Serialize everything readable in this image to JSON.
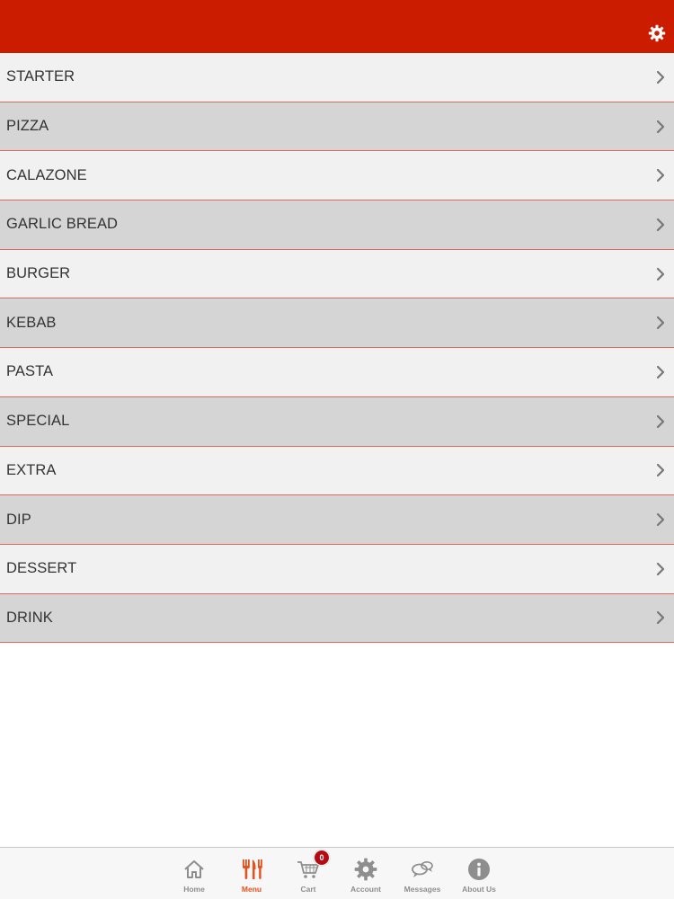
{
  "header": {
    "settings_icon": "gear-icon"
  },
  "colors": {
    "header": "#cc1c00",
    "row_odd": "#f2f1f1",
    "row_even": "#d6d5d5",
    "divider": "#d96a5c",
    "active_tab": "#e8501c"
  },
  "menu": {
    "items": [
      {
        "label": "STARTER"
      },
      {
        "label": "PIZZA"
      },
      {
        "label": "CALAZONE"
      },
      {
        "label": "GARLIC BREAD"
      },
      {
        "label": "BURGER"
      },
      {
        "label": "KEBAB"
      },
      {
        "label": "PASTA"
      },
      {
        "label": "SPECIAL"
      },
      {
        "label": "EXTRA"
      },
      {
        "label": "DIP"
      },
      {
        "label": "DESSERT"
      },
      {
        "label": "DRINK"
      }
    ]
  },
  "tabbar": {
    "tabs": [
      {
        "label": "Home",
        "icon": "home-icon"
      },
      {
        "label": "Menu",
        "icon": "fork-knife-icon"
      },
      {
        "label": "Cart",
        "icon": "cart-icon",
        "badge": "0"
      },
      {
        "label": "Account",
        "icon": "gear-icon"
      },
      {
        "label": "Messages",
        "icon": "chat-bubbles-icon"
      },
      {
        "label": "About Us",
        "icon": "info-icon"
      }
    ],
    "active": "Menu"
  }
}
